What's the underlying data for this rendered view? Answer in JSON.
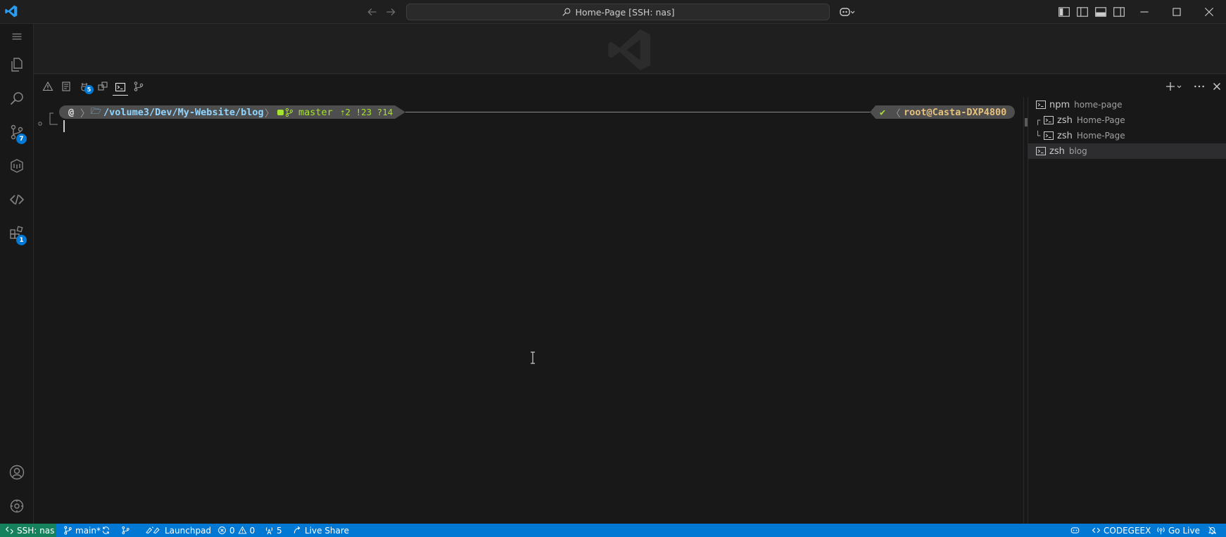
{
  "titlebar": {
    "command_center": "Home-Page [SSH: nas]"
  },
  "activitybar": {
    "items": [
      {
        "name": "explorer",
        "icon": "files-icon"
      },
      {
        "name": "search",
        "icon": "search-icon"
      },
      {
        "name": "source-control",
        "icon": "source-control-icon",
        "badge": "7"
      },
      {
        "name": "remote-explorer",
        "icon": "remote-explorer-icon"
      },
      {
        "name": "codegeex",
        "icon": "codegeex-icon"
      },
      {
        "name": "extensions",
        "icon": "extensions-icon",
        "badge": "1"
      }
    ],
    "bottom": [
      {
        "name": "accounts",
        "icon": "account-icon"
      },
      {
        "name": "manage",
        "icon": "gear-icon"
      }
    ]
  },
  "panel": {
    "tabs": [
      {
        "name": "problems",
        "icon": "warning-icon"
      },
      {
        "name": "output",
        "icon": "output-icon"
      },
      {
        "name": "debug-console",
        "icon": "debug-icon",
        "badge": "5"
      },
      {
        "name": "ports",
        "icon": "ports-icon"
      },
      {
        "name": "terminal",
        "icon": "terminal-icon",
        "active": true
      },
      {
        "name": "gitlens",
        "icon": "gitlens-icon"
      }
    ]
  },
  "prompt": {
    "home_glyph": "@",
    "folder_glyph": "🗁",
    "path_prefix": "/volume3/Dev/",
    "path_repo": "My-Website",
    "path_suffix": "/blog",
    "git_branch": "master",
    "git_status": "⇡2 !23 ?14",
    "check": "✔",
    "user_host": "root@Casta-DXP4800"
  },
  "terminals": [
    {
      "name": "npm",
      "desc": "home-page",
      "tree": ""
    },
    {
      "name": "zsh",
      "desc": "Home-Page",
      "tree": "┌"
    },
    {
      "name": "zsh",
      "desc": "Home-Page",
      "tree": "└"
    },
    {
      "name": "zsh",
      "desc": "blog",
      "tree": "",
      "active": true
    }
  ],
  "statusbar": {
    "remote": "SSH: nas",
    "branch": "main*",
    "launchpad": "Launchpad",
    "errors": "0",
    "warnings": "0",
    "ports": "5",
    "live_share": "Live Share",
    "codegeex": "CODEGEEX",
    "go_live": "Go Live"
  },
  "colors": {
    "accent": "#0078d4",
    "remote": "#16825d",
    "path": "#8fd5ff",
    "git": "#a6e22e",
    "user_host": "#e5c07b"
  }
}
